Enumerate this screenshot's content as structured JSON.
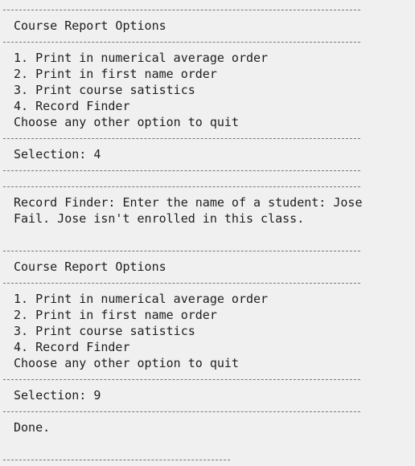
{
  "menu": {
    "title": "Course Report Options",
    "options": [
      "1. Print in numerical average order",
      "2. Print in first name order",
      "3. Print course satistics",
      "4. Record Finder"
    ],
    "quit_hint": "Choose any other option to quit"
  },
  "session": {
    "selection_1": "Selection: 4",
    "finder_prompt": "Record Finder: Enter the name of a student: Jose",
    "finder_result": "Fail. Jose isn't enrolled in this class.",
    "selection_2": "Selection: 9",
    "done": "Done."
  }
}
